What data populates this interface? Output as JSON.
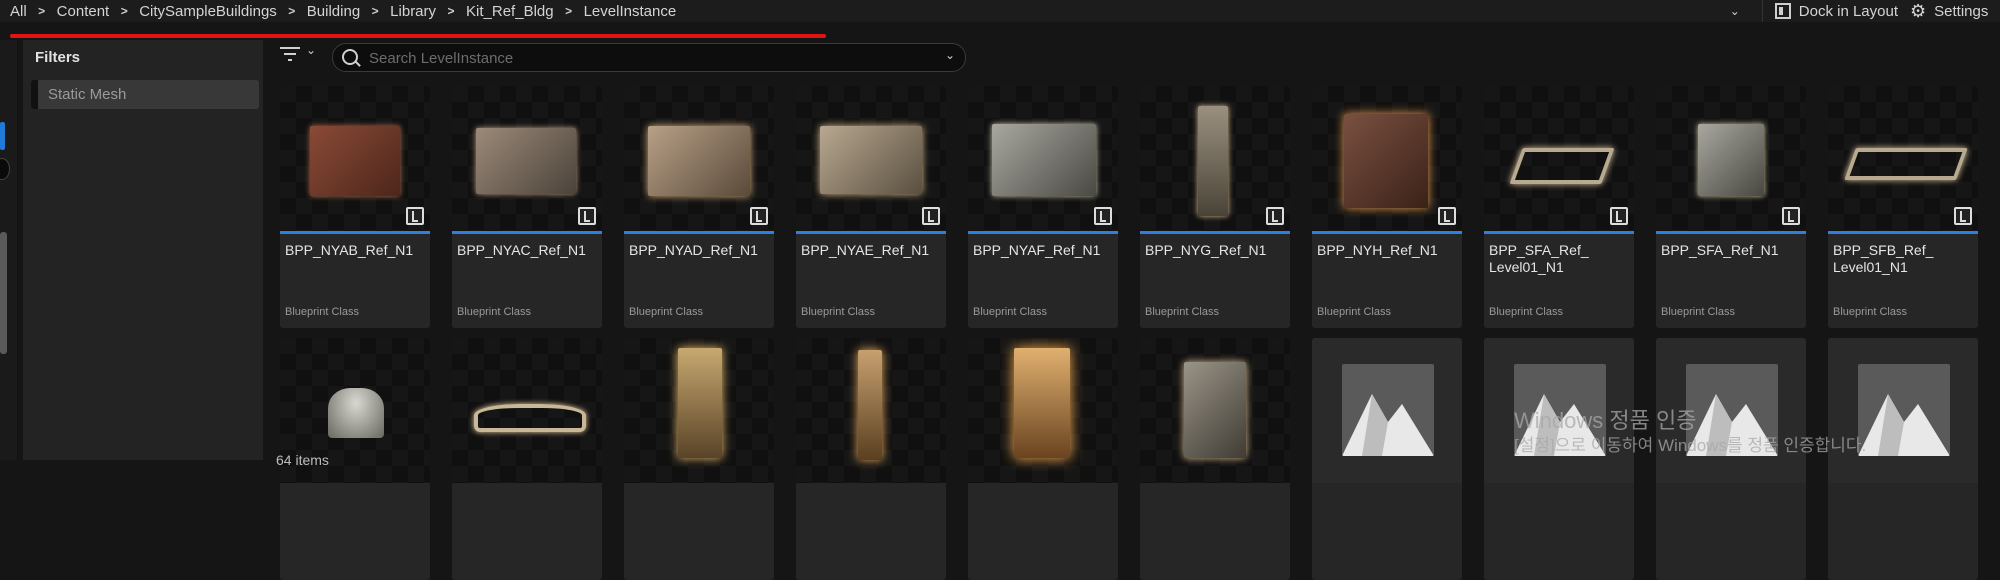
{
  "breadcrumbs": [
    "All",
    "Content",
    "CitySampleBuildings",
    "Building",
    "Library",
    "Kit_Ref_Bldg",
    "LevelInstance"
  ],
  "top_right": {
    "dock_label": "Dock in Layout",
    "settings_label": "Settings"
  },
  "filters": {
    "title": "Filters",
    "items": [
      "Static Mesh"
    ]
  },
  "search": {
    "placeholder": "Search LevelInstance",
    "value": ""
  },
  "assets_row1": [
    {
      "name": "BPP_NYAB_Ref_N1",
      "class": "Blueprint Class"
    },
    {
      "name": "BPP_NYAC_Ref_N1",
      "class": "Blueprint Class"
    },
    {
      "name": "BPP_NYAD_Ref_N1",
      "class": "Blueprint Class"
    },
    {
      "name": "BPP_NYAE_Ref_N1",
      "class": "Blueprint Class"
    },
    {
      "name": "BPP_NYAF_Ref_N1",
      "class": "Blueprint Class"
    },
    {
      "name": "BPP_NYG_Ref_N1",
      "class": "Blueprint Class"
    },
    {
      "name": "BPP_NYH_Ref_N1",
      "class": "Blueprint Class"
    },
    {
      "name": "BPP_SFA_Ref_\nLevel01_N1",
      "class": "Blueprint Class"
    },
    {
      "name": "BPP_SFA_Ref_N1",
      "class": "Blueprint Class"
    },
    {
      "name": "BPP_SFB_Ref_\nLevel01_N1",
      "class": "Blueprint Class"
    }
  ],
  "item_count": "64 items",
  "watermark": {
    "line1": "Windows 정품 인증",
    "line2": "[설정]으로 이동하여 Windows를 정품 인증합니다."
  },
  "colors": {
    "accent_blue": "#2f7fe0",
    "underline_red": "#e01414",
    "background": "#151515",
    "panel": "#232323"
  },
  "icons": [
    "chevron-right-icon",
    "chevron-down-icon",
    "dock-icon",
    "gear-icon",
    "filter-icon",
    "search-icon",
    "level-instance-icon",
    "mountain-placeholder-icon"
  ]
}
